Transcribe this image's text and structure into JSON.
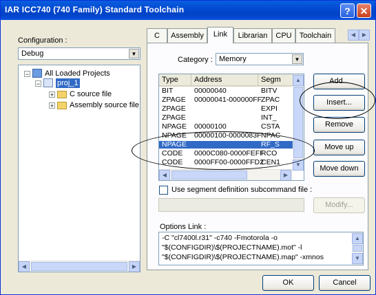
{
  "window": {
    "title": "IAR ICC740 (740 Family) Standard Toolchain"
  },
  "config": {
    "label": "Configuration :",
    "value": "Debug"
  },
  "tree": {
    "root": "All Loaded Projects",
    "project": "proj_1",
    "folders": [
      "C source file",
      "Assembly source file"
    ]
  },
  "tabs": [
    "C",
    "Assembly",
    "Link",
    "Librarian",
    "CPU",
    "Toolchain"
  ],
  "active_tab": "Link",
  "category": {
    "label": "Category :",
    "value": "Memory"
  },
  "segments": {
    "columns": [
      "Type",
      "Address",
      "Segm"
    ],
    "rows": [
      [
        "BIT",
        "00000040",
        "BITV"
      ],
      [
        "ZPAGE",
        "00000041-000000FF",
        "ZPAC"
      ],
      [
        "ZPAGE",
        "",
        "EXPI"
      ],
      [
        "ZPAGE",
        "",
        "INT_"
      ],
      [
        "NPAGE",
        "00000100",
        "CSTA"
      ],
      [
        "NPAGE",
        "00000100-0000083F",
        "NPAC"
      ],
      [
        "NPAGE",
        "",
        "RF_S"
      ],
      [
        "CODE",
        "0000C080-0000FEFF",
        "RCO"
      ],
      [
        "CODE",
        "0000FF00-0000FFD2",
        "CEN1"
      ]
    ],
    "selected_row": 6
  },
  "buttons": {
    "add": "Add...",
    "insert": "Insert...",
    "remove": "Remove",
    "move_up": "Move up",
    "move_down": "Move down",
    "modify": "Modify...",
    "ok": "OK",
    "cancel": "Cancel"
  },
  "use_segment": {
    "label": "Use segment definition subcommand file :",
    "checked": false
  },
  "options": {
    "label": "Options Link :",
    "lines": [
      "-C \"cl7400l.r31\" -c740 -Fmotorola -o",
      "\"$(CONFIGDIR)\\$(PROJECTNAME).mot\" -l",
      "\"$(CONFIGDIR)\\$(PROJECTNAME).map\" -xmnos"
    ]
  },
  "icons": [
    "help-icon",
    "close-icon",
    "folder-icon",
    "workspace-icon",
    "project-icon"
  ]
}
